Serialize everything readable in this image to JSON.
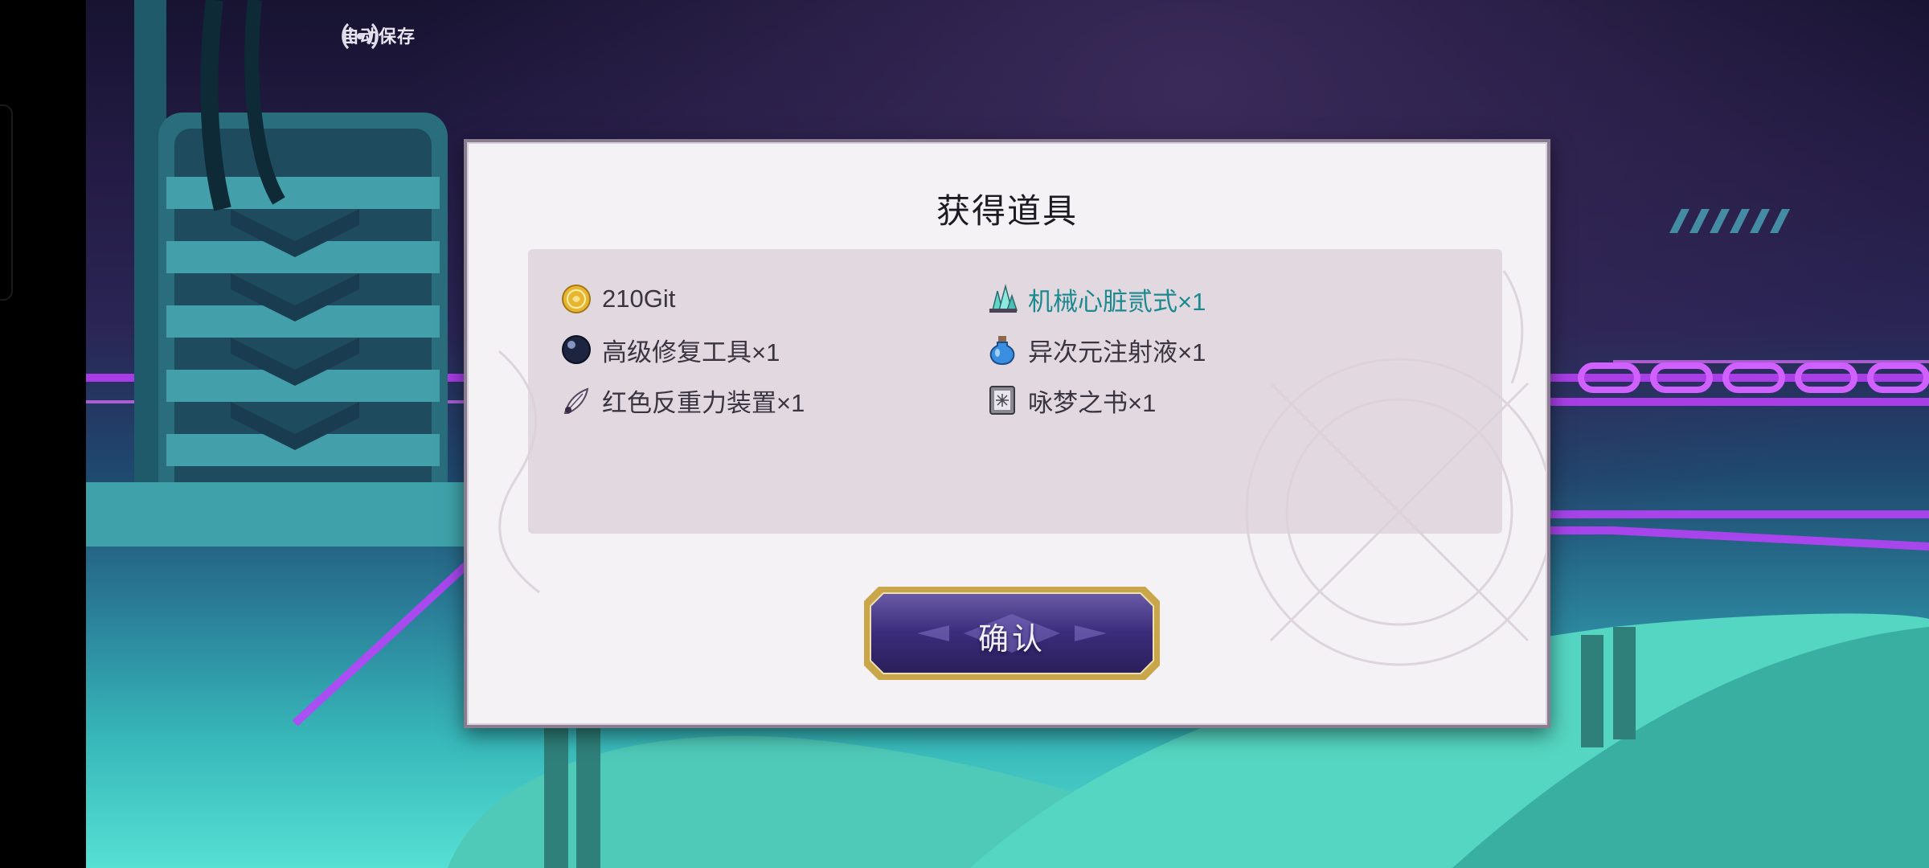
{
  "hud": {
    "autosave_label": "自动保存",
    "autosave_icon": "broadcast-icon"
  },
  "dialog": {
    "title": "获得道具",
    "items": [
      {
        "label": "210Git",
        "icon": "gold-coin-icon",
        "highlight": false
      },
      {
        "label": "机械心脏贰式×1",
        "icon": "crystal-cluster-icon",
        "highlight": true
      },
      {
        "label": "高级修复工具×1",
        "icon": "dark-orb-icon",
        "highlight": false
      },
      {
        "label": "异次元注射液×1",
        "icon": "blue-potion-icon",
        "highlight": false
      },
      {
        "label": "红色反重力装置×1",
        "icon": "feather-device-icon",
        "highlight": false
      },
      {
        "label": "咏梦之书×1",
        "icon": "book-icon",
        "highlight": false
      }
    ],
    "confirm_label": "确认"
  },
  "colors": {
    "highlight_text": "#1b8a8e",
    "button_gold": "#c9a64a",
    "button_purple": "#3a2c7a"
  }
}
